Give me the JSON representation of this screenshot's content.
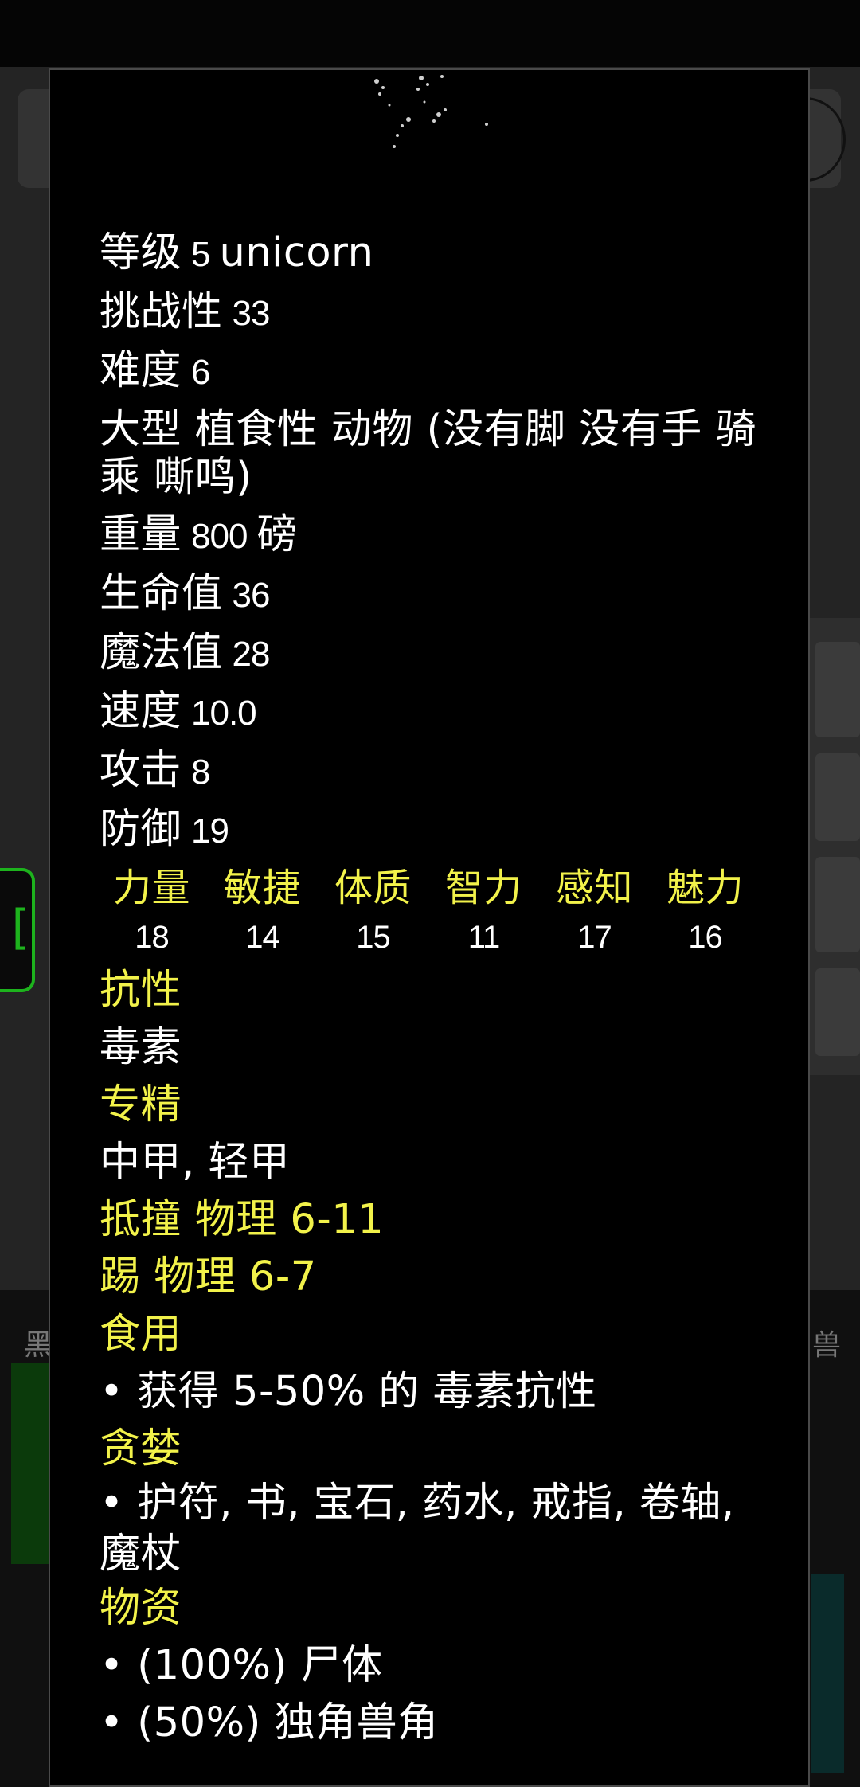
{
  "monster": {
    "level_label": "等级",
    "level": "5",
    "name": "unicorn",
    "challenge_label": "挑战性",
    "challenge": "33",
    "difficulty_label": "难度",
    "difficulty": "6",
    "traits": "大型 植食性 动物 (没有脚 没有手 骑乘 嘶鸣)",
    "weight_label": "重量",
    "weight": "800",
    "weight_unit": "磅",
    "hp_label": "生命值",
    "hp": "36",
    "mp_label": "魔法值",
    "mp": "28",
    "speed_label": "速度",
    "speed": "10.0",
    "attack_label": "攻击",
    "attack": "8",
    "defense_label": "防御",
    "defense": "19"
  },
  "stats": [
    {
      "name": "力量",
      "value": "18"
    },
    {
      "name": "敏捷",
      "value": "14"
    },
    {
      "name": "体质",
      "value": "15"
    },
    {
      "name": "智力",
      "value": "11"
    },
    {
      "name": "感知",
      "value": "17"
    },
    {
      "name": "魅力",
      "value": "16"
    }
  ],
  "resist": {
    "heading": "抗性",
    "value": "毒素"
  },
  "proficiency": {
    "heading": "专精",
    "value": "中甲, 轻甲"
  },
  "attacks": {
    "butt": "抵撞 物理 6-11",
    "kick": "踢 物理 6-7"
  },
  "eat": {
    "heading": "食用",
    "item": "• 获得 5-50% 的 毒素抗性"
  },
  "covet": {
    "heading": "贪婪",
    "item": "• 护符, 书, 宝石, 药水, 戒指, 卷轴, 魔杖"
  },
  "drops": {
    "heading": "物资",
    "items": [
      "• (100%) 尸体",
      "• (50%) 独角兽角"
    ]
  },
  "background": {
    "left_label": "黑",
    "right_label": "兽",
    "green_button": "["
  },
  "colors": {
    "heading_yellow": "#f2f24a",
    "text_white": "#ffffff",
    "background": "#000000",
    "accent_green": "#1db31d"
  }
}
